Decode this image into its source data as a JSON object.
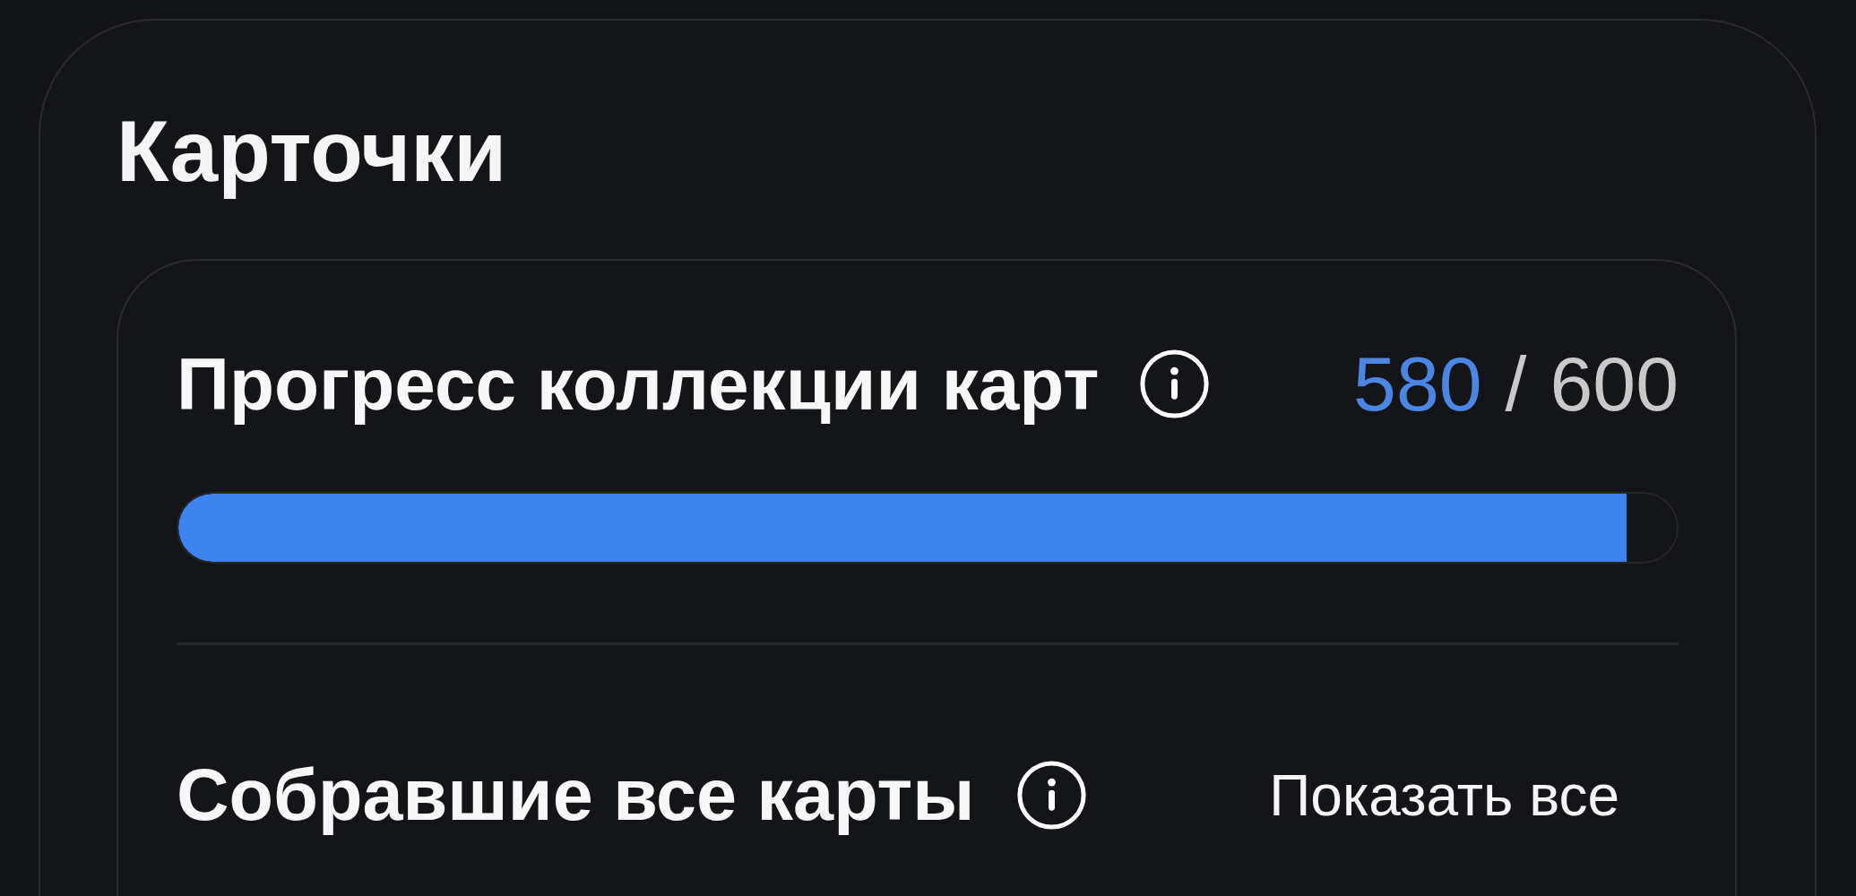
{
  "section": {
    "title": "Карточки"
  },
  "collection_progress": {
    "title": "Прогресс коллекции карт",
    "collected": "580",
    "separator": "/",
    "total": "600",
    "level": 0.9667
  },
  "completed_collectors": {
    "title": "Собравшие все карты",
    "action": "Показать все"
  }
}
